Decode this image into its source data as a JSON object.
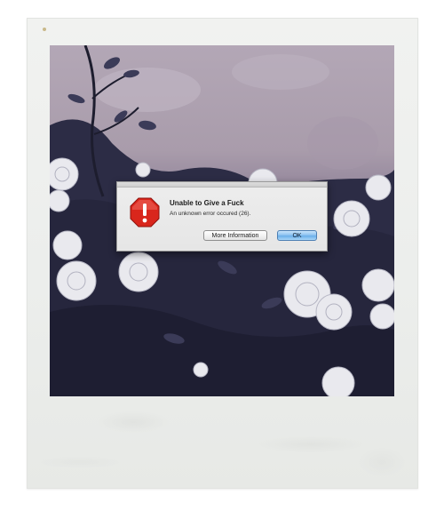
{
  "dialog": {
    "title": "Unable to Give a Fuck",
    "message": "An unknown error occured (26).",
    "icon": "alert-icon",
    "buttons": {
      "more_info_label": "More Information",
      "ok_label": "OK"
    }
  },
  "colors": {
    "alert_red": "#d9261c",
    "ok_button_blue": "#8fc4f1",
    "dialog_bg": "#e8e8e8"
  }
}
